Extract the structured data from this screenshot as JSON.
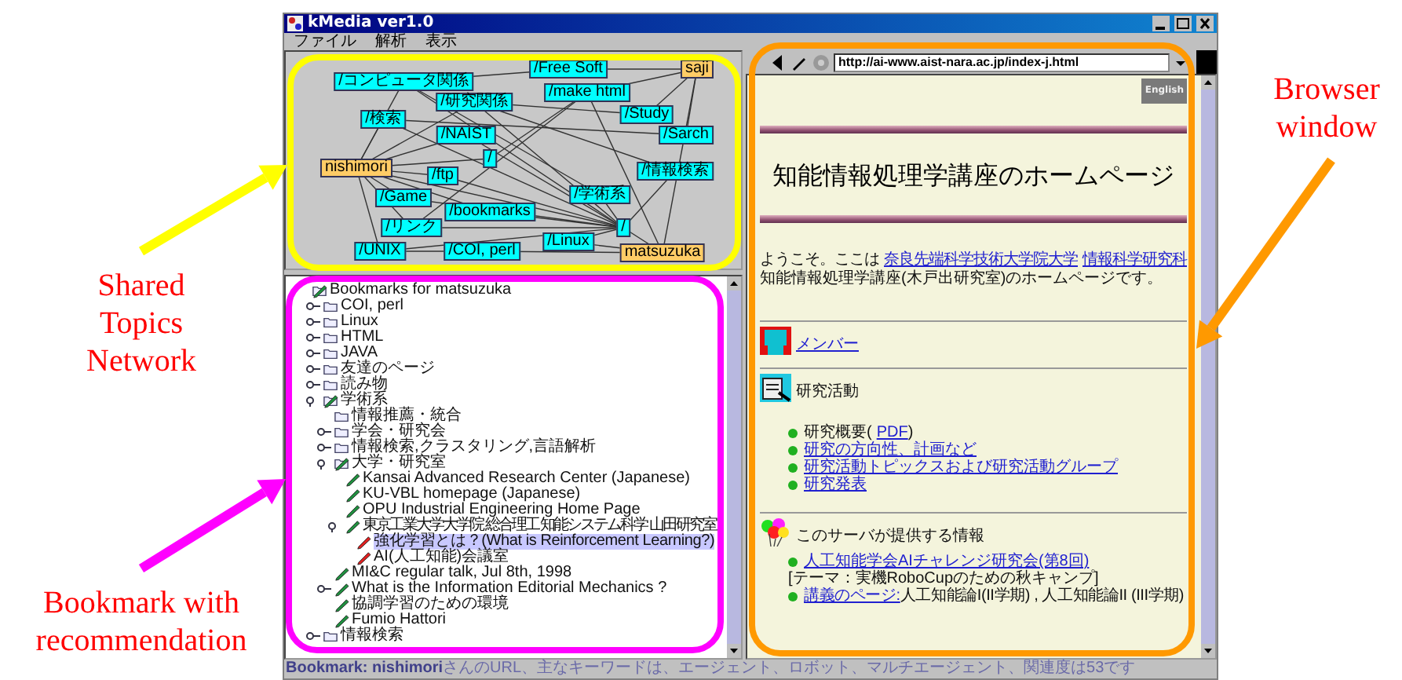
{
  "window": {
    "title": "kMedia ver1.0"
  },
  "menu": [
    "ファイル",
    "解析",
    "表示"
  ],
  "network": {
    "nodes": [
      {
        "label": "/Free Soft",
        "kind": "topic"
      },
      {
        "label": "saji",
        "kind": "user"
      },
      {
        "label": "/コンピュータ関係",
        "kind": "topic"
      },
      {
        "label": "/make html",
        "kind": "topic"
      },
      {
        "label": "/研究関係",
        "kind": "topic"
      },
      {
        "label": "/Study",
        "kind": "topic"
      },
      {
        "label": "/検索",
        "kind": "topic"
      },
      {
        "label": "/Sarch",
        "kind": "topic"
      },
      {
        "label": "/NAIST",
        "kind": "topic"
      },
      {
        "label": "nishimori",
        "kind": "user"
      },
      {
        "label": "/",
        "kind": "topic"
      },
      {
        "label": "/ftp",
        "kind": "topic"
      },
      {
        "label": "/情報検索",
        "kind": "topic"
      },
      {
        "label": "/Game",
        "kind": "topic"
      },
      {
        "label": "/学術系",
        "kind": "topic"
      },
      {
        "label": "/bookmarks",
        "kind": "topic"
      },
      {
        "label": "/リンク",
        "kind": "topic"
      },
      {
        "label": "/",
        "kind": "topic"
      },
      {
        "label": "/UNIX",
        "kind": "topic"
      },
      {
        "label": "/Linux",
        "kind": "topic"
      },
      {
        "label": "/COI, perl",
        "kind": "topic"
      },
      {
        "label": "matsuzuka",
        "kind": "user"
      }
    ]
  },
  "bookmarks": [
    {
      "label": "Bookmarks for matsuzuka",
      "kind": "folder_marked",
      "selected": false,
      "children": [
        {
          "label": "COI, perl",
          "kind": "folder",
          "selected": false,
          "expanded": false
        },
        {
          "label": "Linux",
          "kind": "folder",
          "selected": false,
          "expanded": false
        },
        {
          "label": "HTML",
          "kind": "folder",
          "selected": false,
          "expanded": false
        },
        {
          "label": "JAVA",
          "kind": "folder",
          "selected": false,
          "expanded": false
        },
        {
          "label": "友達のページ",
          "kind": "folder",
          "selected": false,
          "expanded": false
        },
        {
          "label": "読み物",
          "kind": "folder",
          "selected": false,
          "expanded": false
        },
        {
          "label": "学術系",
          "kind": "folder_marked",
          "selected": false,
          "expanded": true,
          "children": [
            {
              "label": "情報推薦・統合",
              "kind": "folder",
              "selected": false
            },
            {
              "label": "学会・研究会",
              "kind": "folder",
              "selected": false,
              "expanded": false
            },
            {
              "label": "情報検索,クラスタリング,言語解析",
              "kind": "folder",
              "selected": false,
              "expanded": false
            },
            {
              "label": "大学・研究室",
              "kind": "folder_marked",
              "selected": false,
              "expanded": true,
              "children": [
                {
                  "label": "Kansai Advanced Research Center (Japanese)",
                  "kind": "bookmark",
                  "selected": false
                },
                {
                  "label": "KU-VBL homepage (Japanese)",
                  "kind": "bookmark",
                  "selected": false
                },
                {
                  "label": "OPU Industrial Engineering Home Page",
                  "kind": "bookmark",
                  "selected": false
                },
                {
                  "label": "東京工業大学大学院 総合理工 知能システム科学 山田研究室",
                  "kind": "bookmark",
                  "selected": false,
                  "expanded": true,
                  "children": [
                    {
                      "label": "強化学習とは？(What is Reinforcement Learning?)",
                      "kind": "recommended",
                      "selected": true
                    },
                    {
                      "label": "AI(人工知能)会議室",
                      "kind": "recommended",
                      "selected": false
                    }
                  ]
                }
              ]
            },
            {
              "label": "MI&C regular talk, Jul 8th, 1998",
              "kind": "bookmark",
              "selected": false
            },
            {
              "label": "What is the Information Editorial Mechanics ?",
              "kind": "bookmark",
              "selected": false,
              "expanded": false
            },
            {
              "label": "協調学習のための環境",
              "kind": "bookmark",
              "selected": false
            },
            {
              "label": "Fumio Hattori",
              "kind": "bookmark",
              "selected": false
            }
          ]
        },
        {
          "label": "情報検索",
          "kind": "folder",
          "selected": false,
          "expanded": false
        }
      ]
    }
  ],
  "status_bar": "**Bookmark: nishimori**さんのURL、主なキーワードは、エージェント、ロボット、マルチエージェント、関連度は53です",
  "browser": {
    "url": "http://ai-www.aist-nara.ac.jp/index-j.html",
    "language_button": "English",
    "page_title": "知能情報処理学講座のホームページ",
    "intro_lines": [
      [
        {
          "kind": "text",
          "text": "ようこそ。ここは"
        },
        {
          "kind": "link",
          "text": "奈良先端科学技術大学院大学"
        },
        {
          "kind": "link",
          "text": "情報科学研究科"
        }
      ],
      [
        {
          "kind": "text",
          "text": "知能情報処理学講座(木戸出研究室)のホームページです。"
        }
      ]
    ],
    "sections": [
      {
        "kind": "members",
        "heading": "メンバー",
        "heading_link": true
      },
      {
        "kind": "research",
        "heading": "研究活動",
        "heading_link": false,
        "items": [
          {
            "parts": [
              {
                "kind": "text",
                "text": "研究概要("
              },
              {
                "kind": "link",
                "text": "PDF"
              },
              {
                "kind": "text",
                "text": ")"
              }
            ]
          },
          {
            "parts": [
              {
                "kind": "link",
                "text": "研究の方向性、計画など"
              }
            ]
          },
          {
            "parts": [
              {
                "kind": "link",
                "text": "研究活動トピックスおよび研究活動グループ"
              }
            ]
          },
          {
            "parts": [
              {
                "kind": "link",
                "text": "研究発表"
              }
            ]
          }
        ]
      },
      {
        "kind": "balloons",
        "heading": "このサーバが提供する情報",
        "heading_link": false,
        "items": [
          {
            "parts": [
              {
                "kind": "link",
                "text": "人工知能学会AIチャレンジ研究会(第8回)"
              }
            ],
            "note": "[テーマ：実機RoboCupのための秋キャンプ]"
          },
          {
            "parts": [
              {
                "kind": "link",
                "text": "講義のページ:"
              },
              {
                "kind": "text",
                "text": "人工知能論I(II学期) , 人工知能論II (III学期)"
              }
            ]
          }
        ]
      }
    ]
  },
  "annotations": [
    {
      "label": "Shared Topics Network",
      "color": "#ffff00"
    },
    {
      "label": "Bookmark with recommendation",
      "color": "#ff00ff"
    },
    {
      "label": "Browser window",
      "color": "#ff9900"
    }
  ]
}
